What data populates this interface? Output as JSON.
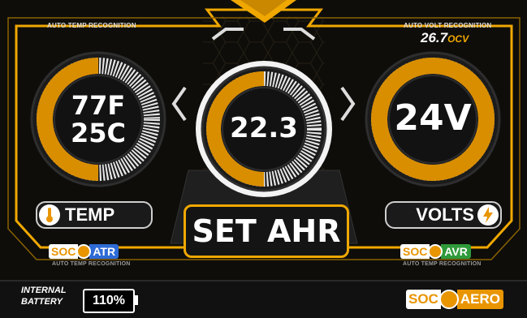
{
  "labels": {
    "auto_temp_top": "AUTO TEMP RECOGNITION",
    "auto_volt_top": "AUTO VOLT RECOGNITION",
    "auto_temp_bottom_left": "AUTO TEMP RECOGNITION",
    "auto_temp_bottom_right": "AUTO TEMP RECOGNITION"
  },
  "ocv": {
    "value": "26.7",
    "unit": "OCV"
  },
  "gauges": {
    "temp": {
      "line1": "77F",
      "line2": "25C",
      "level": 0.5
    },
    "ahr": {
      "value": "22.3",
      "level": 0.5
    },
    "volts": {
      "value": "24V",
      "level": 1.0
    }
  },
  "buttons": {
    "temp": "TEMP",
    "volts": "VOLTS",
    "set_ahr": "SET AHR"
  },
  "badges": {
    "soc": "SOC",
    "atr": "ATR",
    "avr": "AVR",
    "aero": "AERO"
  },
  "footer": {
    "internal_line1": "INTERNAL",
    "internal_line2": "BATTERY",
    "battery_percent": "110%"
  },
  "colors": {
    "accent": "#f0a800",
    "gauge_fill": "#d98e00",
    "gauge_empty": "#e8e8e8",
    "atr_tag": "#2e6bd6",
    "avr_tag": "#2f9a3a",
    "background": "#0b0b0b"
  },
  "icons": [
    "thermometer-icon",
    "lightning-icon",
    "soc-logo-icon"
  ]
}
